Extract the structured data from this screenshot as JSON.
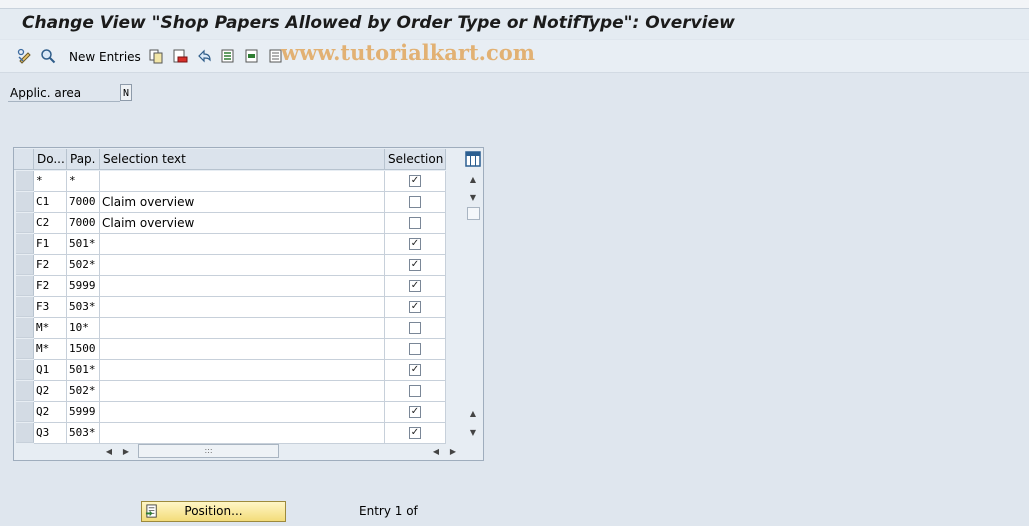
{
  "title": "Change View \"Shop Papers Allowed by Order Type or NotifType\": Overview",
  "toolbar": {
    "new_entries_label": "New Entries",
    "watermark": "www.tutorialkart.com",
    "icons": [
      "edit-display-icon",
      "details-icon",
      "copy-icon",
      "delete-icon",
      "undo-icon",
      "select-all-icon",
      "select-block-icon",
      "deselect-all-icon"
    ]
  },
  "filter": {
    "label": "Applic. area",
    "value": "N"
  },
  "table": {
    "headers": [
      "Do...",
      "Pap.",
      "Selection text",
      "Selection"
    ],
    "rows": [
      {
        "doc": "*",
        "pap": "*",
        "text": "",
        "selected": true
      },
      {
        "doc": "C1",
        "pap": "7000",
        "text": "Claim overview",
        "selected": false
      },
      {
        "doc": "C2",
        "pap": "7000",
        "text": "Claim overview",
        "selected": false
      },
      {
        "doc": "F1",
        "pap": "501*",
        "text": "",
        "selected": true
      },
      {
        "doc": "F2",
        "pap": "502*",
        "text": "",
        "selected": true
      },
      {
        "doc": "F2",
        "pap": "5999",
        "text": "",
        "selected": true
      },
      {
        "doc": "F3",
        "pap": "503*",
        "text": "",
        "selected": true
      },
      {
        "doc": "M*",
        "pap": "10*",
        "text": "",
        "selected": false
      },
      {
        "doc": "M*",
        "pap": "1500",
        "text": "",
        "selected": false
      },
      {
        "doc": "Q1",
        "pap": "501*",
        "text": "",
        "selected": true
      },
      {
        "doc": "Q2",
        "pap": "502*",
        "text": "",
        "selected": false
      },
      {
        "doc": "Q2",
        "pap": "5999",
        "text": "",
        "selected": true
      },
      {
        "doc": "Q3",
        "pap": "503*",
        "text": "",
        "selected": true
      }
    ]
  },
  "footer": {
    "position_label": "Position...",
    "entry_text": "Entry 1 of"
  }
}
